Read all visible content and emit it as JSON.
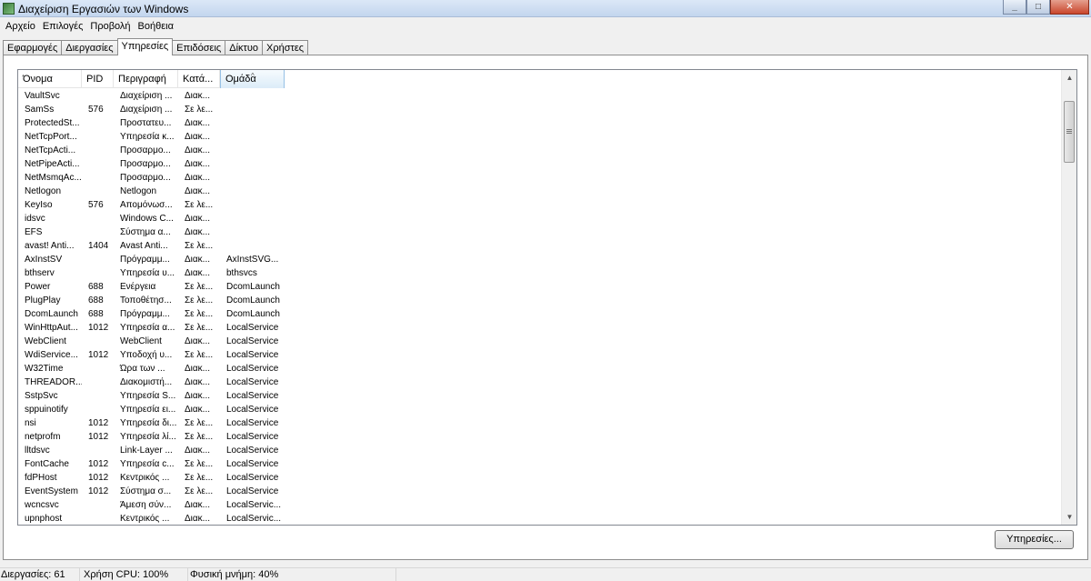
{
  "window": {
    "title": "Διαχείριση Εργασιών των Windows"
  },
  "menu": [
    "Αρχείο",
    "Επιλογές",
    "Προβολή",
    "Βοήθεια"
  ],
  "tabs": [
    {
      "label": "Εφαρμογές",
      "active": false
    },
    {
      "label": "Διεργασίες",
      "active": false
    },
    {
      "label": "Υπηρεσίες",
      "active": true
    },
    {
      "label": "Επιδόσεις",
      "active": false
    },
    {
      "label": "Δίκτυο",
      "active": false
    },
    {
      "label": "Χρήστες",
      "active": false
    }
  ],
  "table": {
    "columns": [
      "Όνομα",
      "PID",
      "Περιγραφή",
      "Κατά...",
      "Ομάδα"
    ],
    "sorted_column": 4,
    "rows": [
      [
        "VaultSvc",
        "",
        "Διαχείριση ...",
        "Διακ...",
        ""
      ],
      [
        "SamSs",
        "576",
        "Διαχείριση ...",
        "Σε λε...",
        ""
      ],
      [
        "ProtectedSt...",
        "",
        "Προστατευ...",
        "Διακ...",
        ""
      ],
      [
        "NetTcpPort...",
        "",
        "Υπηρεσία κ...",
        "Διακ...",
        ""
      ],
      [
        "NetTcpActi...",
        "",
        "Προσαρμο...",
        "Διακ...",
        ""
      ],
      [
        "NetPipeActi...",
        "",
        "Προσαρμο...",
        "Διακ...",
        ""
      ],
      [
        "NetMsmqAc...",
        "",
        "Προσαρμο...",
        "Διακ...",
        ""
      ],
      [
        "Netlogon",
        "",
        "Netlogon",
        "Διακ...",
        ""
      ],
      [
        "KeyIso",
        "576",
        "Απομόνωσ...",
        "Σε λε...",
        ""
      ],
      [
        "idsvc",
        "",
        "Windows C...",
        "Διακ...",
        ""
      ],
      [
        "EFS",
        "",
        "Σύστημα α...",
        "Διακ...",
        ""
      ],
      [
        "avast! Anti...",
        "1404",
        "Avast Anti...",
        "Σε λε...",
        ""
      ],
      [
        "AxInstSV",
        "",
        "Πρόγραμμ...",
        "Διακ...",
        "AxInstSVG..."
      ],
      [
        "bthserv",
        "",
        "Υπηρεσία υ...",
        "Διακ...",
        "bthsvcs"
      ],
      [
        "Power",
        "688",
        "Ενέργεια",
        "Σε λε...",
        "DcomLaunch"
      ],
      [
        "PlugPlay",
        "688",
        "Τοποθέτησ...",
        "Σε λε...",
        "DcomLaunch"
      ],
      [
        "DcomLaunch",
        "688",
        "Πρόγραμμ...",
        "Σε λε...",
        "DcomLaunch"
      ],
      [
        "WinHttpAut...",
        "1012",
        "Υπηρεσία α...",
        "Σε λε...",
        "LocalService"
      ],
      [
        "WebClient",
        "",
        "WebClient",
        "Διακ...",
        "LocalService"
      ],
      [
        "WdiService...",
        "1012",
        "Υποδοχή υ...",
        "Σε λε...",
        "LocalService"
      ],
      [
        "W32Time",
        "",
        "Ώρα των ...",
        "Διακ...",
        "LocalService"
      ],
      [
        "THREADOR...",
        "",
        "Διακομιστή...",
        "Διακ...",
        "LocalService"
      ],
      [
        "SstpSvc",
        "",
        "Υπηρεσία S...",
        "Διακ...",
        "LocalService"
      ],
      [
        "sppuinotify",
        "",
        "Υπηρεσία ει...",
        "Διακ...",
        "LocalService"
      ],
      [
        "nsi",
        "1012",
        "Υπηρεσία δι...",
        "Σε λε...",
        "LocalService"
      ],
      [
        "netprofm",
        "1012",
        "Υπηρεσία λί...",
        "Σε λε...",
        "LocalService"
      ],
      [
        "lltdsvc",
        "",
        "Link-Layer ...",
        "Διακ...",
        "LocalService"
      ],
      [
        "FontCache",
        "1012",
        "Υπηρεσία c...",
        "Σε λε...",
        "LocalService"
      ],
      [
        "fdPHost",
        "1012",
        "Κεντρικός ...",
        "Σε λε...",
        "LocalService"
      ],
      [
        "EventSystem",
        "1012",
        "Σύστημα σ...",
        "Σε λε...",
        "LocalService"
      ],
      [
        "wcncsvc",
        "",
        "Άμεση σύν...",
        "Διακ...",
        "LocalServic..."
      ],
      [
        "upnphost",
        "",
        "Κεντρικός ...",
        "Διακ...",
        "LocalServic..."
      ]
    ]
  },
  "buttons": {
    "services": "Υπηρεσίες..."
  },
  "status": {
    "processes": "Διεργασίες: 61",
    "cpu": "Χρήση CPU: 100%",
    "memory": "Φυσική μνήμη: 40%"
  },
  "icons": {
    "minimize": "minimize-icon",
    "maximize": "maximize-icon",
    "close": "close-icon",
    "sort": "sort-ascending-icon"
  }
}
